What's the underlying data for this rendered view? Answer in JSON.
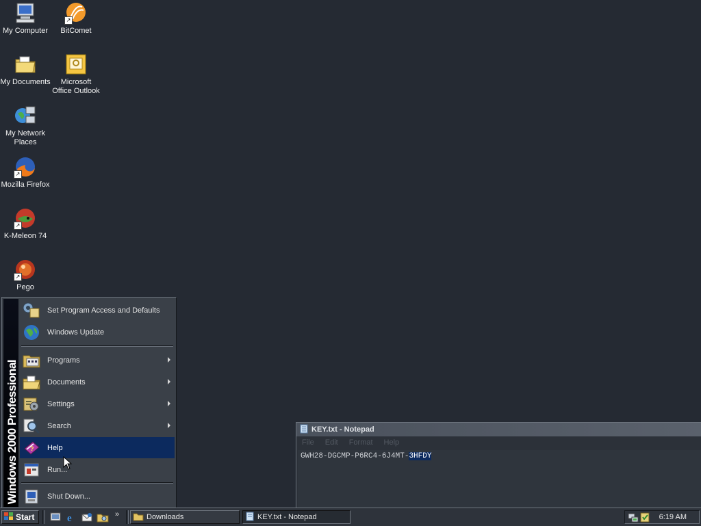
{
  "desktop": {
    "icons": [
      {
        "label": "My Computer",
        "icon": "computer-icon"
      },
      {
        "label": "BitComet",
        "icon": "bitcomet-icon",
        "shortcut": true
      },
      {
        "label": "My Documents",
        "icon": "folder-documents-icon"
      },
      {
        "label": "Microsoft Office Outlook",
        "icon": "outlook-icon"
      },
      {
        "label": "My Network Places",
        "icon": "network-icon"
      },
      {
        "label": "Mozilla Firefox",
        "icon": "firefox-icon",
        "shortcut": true
      },
      {
        "label": "K-Meleon 74",
        "icon": "kmeleon-icon",
        "shortcut": true
      },
      {
        "label": "Pego",
        "icon": "pego-icon",
        "shortcut": true
      }
    ]
  },
  "start_menu": {
    "banner": "Windows 2000 Professional",
    "items": [
      {
        "label": "Set Program Access and Defaults",
        "icon": "program-access-icon",
        "submenu": false
      },
      {
        "label": "Windows Update",
        "icon": "windows-update-icon",
        "submenu": false
      },
      {
        "label": "Programs",
        "icon": "programs-icon",
        "submenu": true
      },
      {
        "label": "Documents",
        "icon": "documents-icon",
        "submenu": true
      },
      {
        "label": "Settings",
        "icon": "settings-icon",
        "submenu": true
      },
      {
        "label": "Search",
        "icon": "search-icon",
        "submenu": true
      },
      {
        "label": "Help",
        "icon": "help-icon",
        "submenu": false,
        "active": true
      },
      {
        "label": "Run...",
        "icon": "run-icon",
        "submenu": false
      },
      {
        "label": "Shut Down...",
        "icon": "shutdown-icon",
        "submenu": false
      }
    ]
  },
  "notepad": {
    "title": "KEY.txt - Notepad",
    "menu": [
      "File",
      "Edit",
      "Format",
      "Help"
    ],
    "content_plain": "GWH28-DGCMP-P6RC4-6J4MT-",
    "content_selected": "3HFDY"
  },
  "taskbar": {
    "start_label": "Start",
    "quick_launch": [
      "show-desktop-icon",
      "internet-explorer-icon",
      "outlook-express-icon",
      "explore-icon"
    ],
    "more_label": "»",
    "tasks": [
      {
        "label": "Downloads",
        "icon": "folder-icon",
        "pressed": false
      },
      {
        "label": "KEY.txt - Notepad",
        "icon": "notepad-icon",
        "pressed": true
      }
    ],
    "clock": "6:19 AM"
  },
  "colors": {
    "desktop_bg": "#252a33",
    "highlight": "#0c2a5e"
  }
}
